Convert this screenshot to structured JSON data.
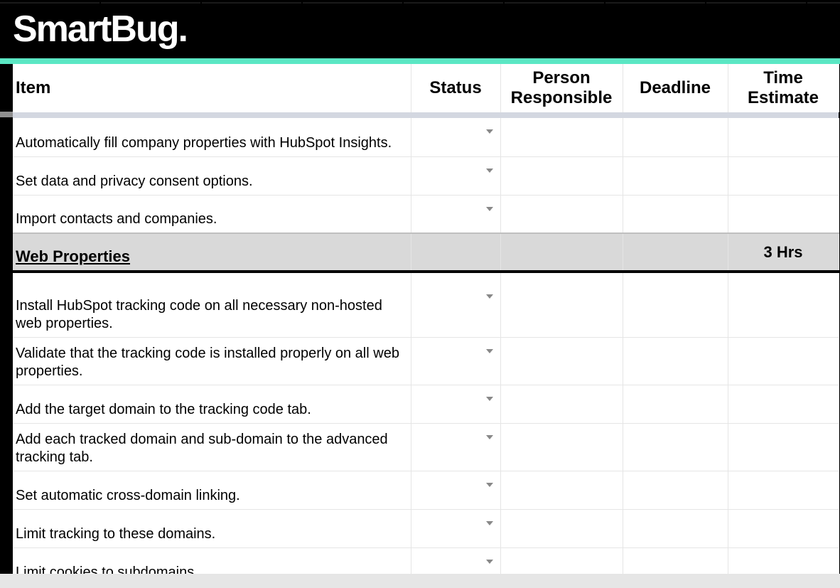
{
  "brand": {
    "logo_text": "SmartBug."
  },
  "columns": {
    "item": "Item",
    "status": "Status",
    "person": "Person Responsible",
    "deadline": "Deadline",
    "time": "Time Estimate"
  },
  "rows": [
    {
      "type": "task",
      "item": "Automatically fill company properties with HubSpot Insights.",
      "status": "",
      "person": "",
      "deadline": "",
      "time": ""
    },
    {
      "type": "task",
      "item": "Set data and privacy consent options.",
      "status": "",
      "person": "",
      "deadline": "",
      "time": ""
    },
    {
      "type": "task",
      "item": "Import contacts and companies.",
      "status": "",
      "person": "",
      "deadline": "",
      "time": ""
    },
    {
      "type": "section",
      "item": "Web Properties",
      "time": "3 Hrs"
    },
    {
      "type": "task",
      "tall": true,
      "item": "Install HubSpot tracking code on all necessary non-hosted web properties.",
      "status": "",
      "person": "",
      "deadline": "",
      "time": ""
    },
    {
      "type": "task",
      "item": "Validate that the tracking code is installed properly on all web properties.",
      "status": "",
      "person": "",
      "deadline": "",
      "time": ""
    },
    {
      "type": "task",
      "item": "Add the target domain to the tracking code tab.",
      "status": "",
      "person": "",
      "deadline": "",
      "time": ""
    },
    {
      "type": "task",
      "item": "Add each tracked domain and sub-domain to the advanced tracking tab.",
      "status": "",
      "person": "",
      "deadline": "",
      "time": ""
    },
    {
      "type": "task",
      "item": "Set automatic cross-domain linking.",
      "status": "",
      "person": "",
      "deadline": "",
      "time": ""
    },
    {
      "type": "task",
      "item": "Limit tracking to these domains.",
      "status": "",
      "person": "",
      "deadline": "",
      "time": ""
    },
    {
      "type": "task",
      "item": "Limit cookies to subdomains.",
      "status": "",
      "person": "",
      "deadline": "",
      "time": ""
    }
  ],
  "colors": {
    "mint": "#5be7c4",
    "section_bg": "#d9d9d9",
    "divider": "#d3d7e0"
  }
}
